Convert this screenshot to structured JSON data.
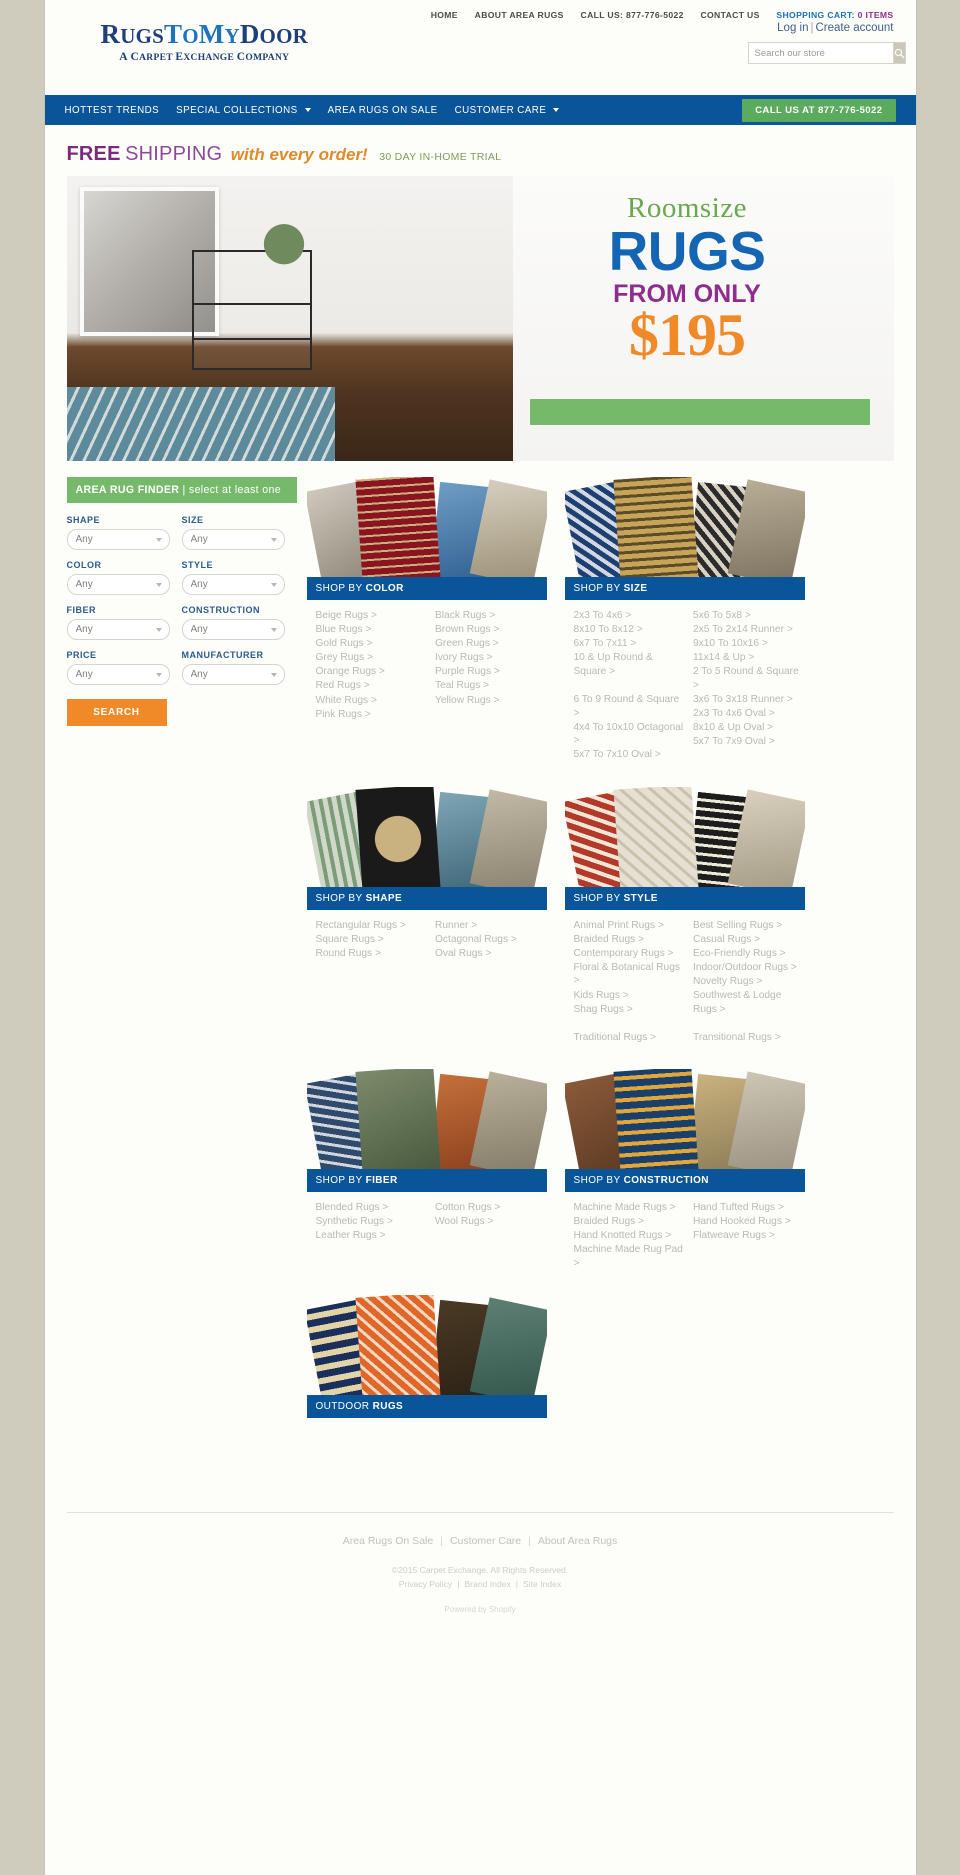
{
  "header": {
    "logo": {
      "part1": "Rugs",
      "part2": "ToMy",
      "part3": "Door",
      "tagline": "A Carpet Exchange Company"
    },
    "toplinks": [
      {
        "label": "HOME"
      },
      {
        "label": "ABOUT AREA RUGS"
      },
      {
        "label": "CALL US: 877-776-5022"
      },
      {
        "label": "CONTACT US"
      }
    ],
    "cart_label": "SHOPPING CART:",
    "cart_items": "0 ITEMS",
    "login": "Log in",
    "separator": "|",
    "create_account": "Create account",
    "search": {
      "placeholder": "Search our store",
      "value": "",
      "icon": "search-icon"
    }
  },
  "nav": {
    "items": [
      {
        "label": "HOTTEST TRENDS",
        "caret": false
      },
      {
        "label": "SPECIAL COLLECTIONS",
        "caret": true
      },
      {
        "label": "AREA RUGS ON SALE",
        "caret": false
      },
      {
        "label": "CUSTOMER CARE",
        "caret": true
      }
    ],
    "call_button": "CALL US AT 877-776-5022"
  },
  "promo": {
    "free": "FREE",
    "shipping": "SHIPPING",
    "order": "with every order!",
    "trial": "30 DAY IN-HOME TRIAL"
  },
  "hero": {
    "roomsize": "Roomsize",
    "rugs": "RUGS",
    "from_only": "FROM ONLY",
    "price": "$195"
  },
  "finder": {
    "title": "AREA RUG FINDER",
    "subtitle": " | select at least one",
    "fields": [
      {
        "label": "SHAPE",
        "value": "Any"
      },
      {
        "label": "SIZE",
        "value": "Any"
      },
      {
        "label": "COLOR",
        "value": "Any"
      },
      {
        "label": "STYLE",
        "value": "Any"
      },
      {
        "label": "FIBER",
        "value": "Any"
      },
      {
        "label": "CONSTRUCTION",
        "value": "Any"
      },
      {
        "label": "PRICE",
        "value": "Any"
      },
      {
        "label": "MANUFACTURER",
        "value": "Any"
      }
    ],
    "search_button": "SEARCH"
  },
  "cards": [
    {
      "bar_prefix": "SHOP BY ",
      "bar_bold": "COLOR",
      "col1": [
        "Beige Rugs >",
        "Blue Rugs >",
        "Gold Rugs >",
        "Grey Rugs >",
        "Orange Rugs >",
        "Red Rugs >",
        "White Rugs >",
        "Pink Rugs >"
      ],
      "col2": [
        "Black Rugs >",
        "Brown Rugs >",
        "Green Rugs >",
        "Ivory Rugs >",
        "Purple Rugs >",
        "Teal Rugs >",
        "Yellow Rugs >"
      ]
    },
    {
      "bar_prefix": "SHOP BY ",
      "bar_bold": "SIZE",
      "col1": [
        "2x3 To 4x6 >",
        "8x10 To 8x12 >",
        "6x7 To 7x11 >",
        "10 & Up Round & Square >",
        "",
        "6 To 9 Round & Square >",
        "4x4 To 10x10 Octagonal >",
        "5x7 To 7x10 Oval >"
      ],
      "col2": [
        "5x6 To 5x8 >",
        "2x5 To 2x14 Runner >",
        "9x10 To 10x16 >",
        "11x14 & Up >",
        "2 To 5 Round & Square >",
        "3x6 To 3x18 Runner >",
        "2x3 To 4x6 Oval >",
        "8x10 & Up Oval >",
        "5x7 To 7x9 Oval >"
      ]
    },
    {
      "bar_prefix": "SHOP BY ",
      "bar_bold": "SHAPE",
      "col1": [
        "Rectangular Rugs >",
        "Square Rugs >",
        "Round Rugs >"
      ],
      "col2": [
        "Runner >",
        "Octagonal Rugs >",
        "Oval Rugs >"
      ]
    },
    {
      "bar_prefix": "SHOP BY ",
      "bar_bold": "STYLE",
      "col1": [
        "Animal Print Rugs >",
        "Braided Rugs >",
        "Contemporary Rugs >",
        "Floral & Botanical Rugs >",
        "Kids Rugs >",
        "Shag Rugs >",
        "",
        "Traditional Rugs >"
      ],
      "col2": [
        "Best Selling Rugs >",
        "Casual Rugs >",
        "Eco-Friendly Rugs >",
        "Indoor/Outdoor Rugs >",
        "Novelty Rugs >",
        "Southwest & Lodge Rugs >",
        "",
        "Transitional Rugs >"
      ]
    },
    {
      "bar_prefix": "SHOP BY ",
      "bar_bold": "FIBER",
      "col1": [
        "Blended Rugs >",
        "Synthetic Rugs >",
        "Leather Rugs >"
      ],
      "col2": [
        "Cotton Rugs >",
        "Wool Rugs >"
      ]
    },
    {
      "bar_prefix": "SHOP BY ",
      "bar_bold": "CONSTRUCTION",
      "col1": [
        "Machine Made Rugs >",
        "Braided Rugs >",
        "Hand Knotted Rugs >",
        "Machine Made Rug Pad >"
      ],
      "col2": [
        "Hand Tufted Rugs >",
        "Hand Hooked Rugs >",
        "Flatweave Rugs >"
      ]
    },
    {
      "bar_prefix": "OUTDOOR ",
      "bar_bold": "RUGS",
      "col1": [],
      "col2": []
    }
  ],
  "footer": {
    "nav": [
      "Area Rugs On Sale",
      "Customer Care",
      "About Area Rugs"
    ],
    "separator": "|",
    "copyright": "©2015 Carpet Exchange. All Rights Reserved.",
    "links": [
      "Privacy Policy",
      "Brand Index",
      "Site Index"
    ],
    "powered": "Powered by Shopify"
  },
  "colors": {
    "brand_blue": "#0a5599",
    "green": "#76b96b",
    "orange": "#f08a28",
    "purple": "#7c2b7c"
  }
}
